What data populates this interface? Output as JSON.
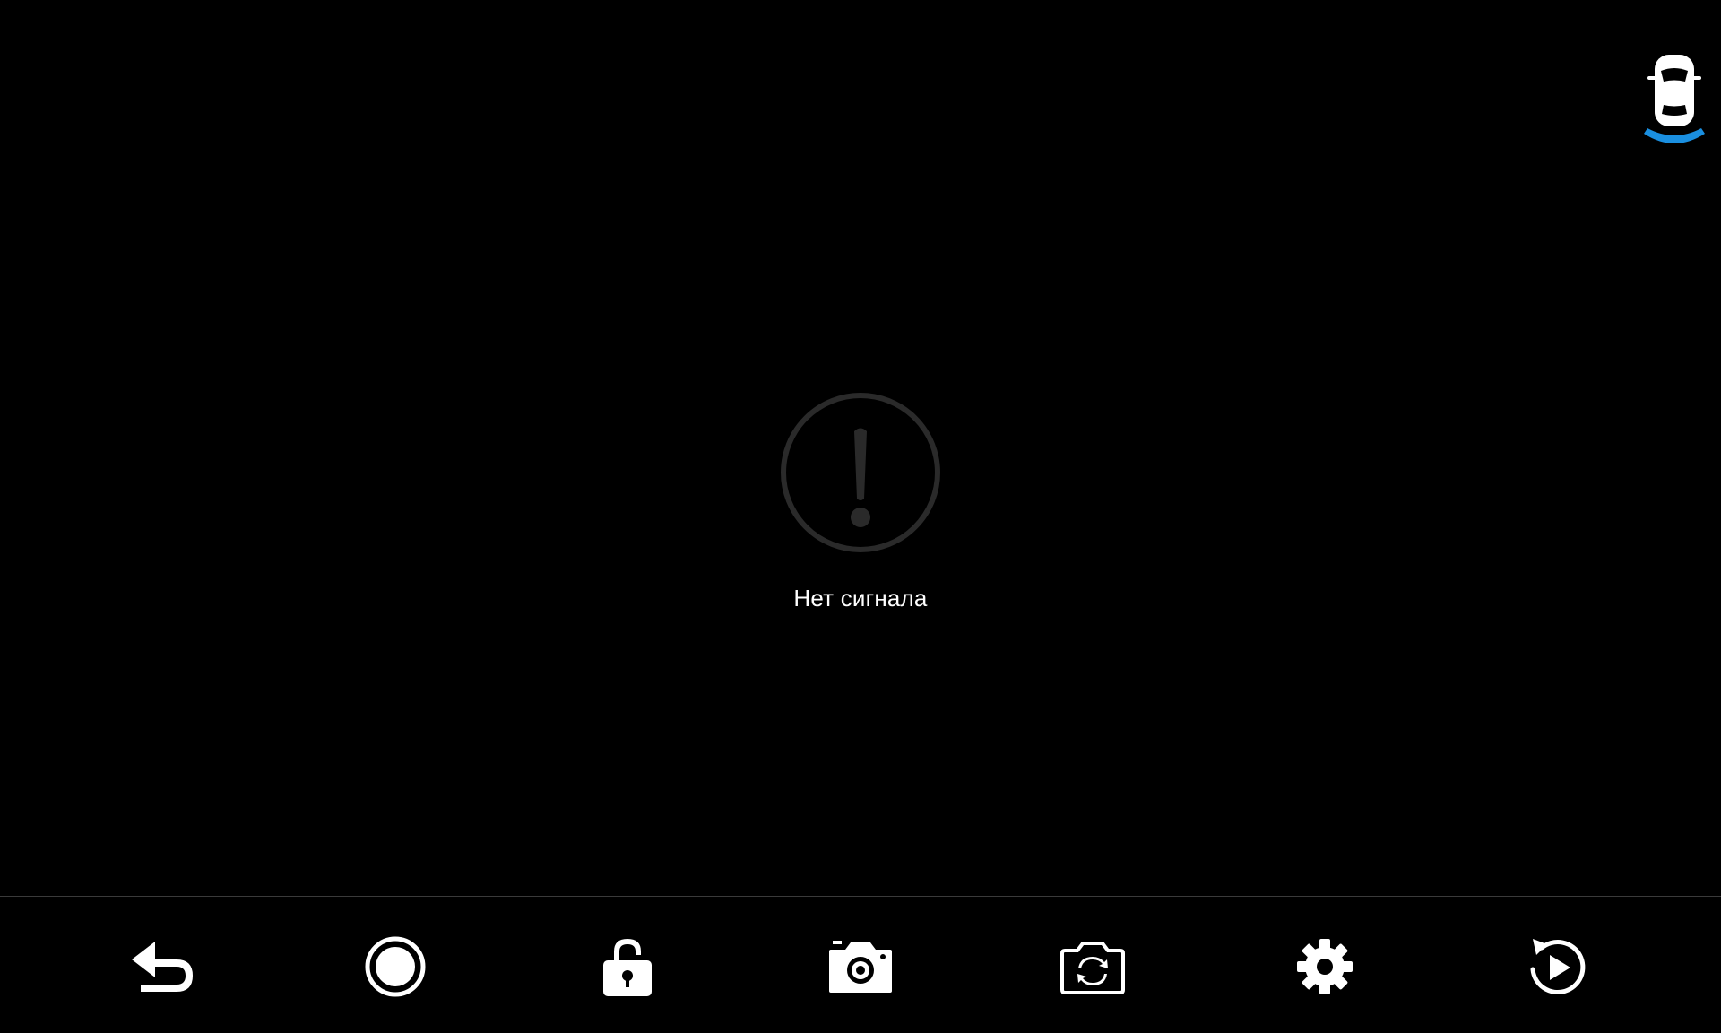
{
  "status": {
    "message": "Нет сигнала",
    "icon": "warning-icon"
  },
  "parking_sensor": {
    "icon": "car-parking-sensor-icon",
    "arc_color": "#1a8fe0"
  },
  "toolbar": {
    "buttons": [
      {
        "id": "back",
        "icon": "back-arrow-icon"
      },
      {
        "id": "record",
        "icon": "record-icon"
      },
      {
        "id": "lock",
        "icon": "unlock-icon"
      },
      {
        "id": "photo",
        "icon": "camera-icon"
      },
      {
        "id": "switch-camera",
        "icon": "switch-camera-icon"
      },
      {
        "id": "settings",
        "icon": "gear-icon"
      },
      {
        "id": "playback",
        "icon": "playback-icon"
      }
    ]
  },
  "colors": {
    "background": "#000000",
    "icon": "#ffffff",
    "warning_ring": "#2a2a2a"
  }
}
